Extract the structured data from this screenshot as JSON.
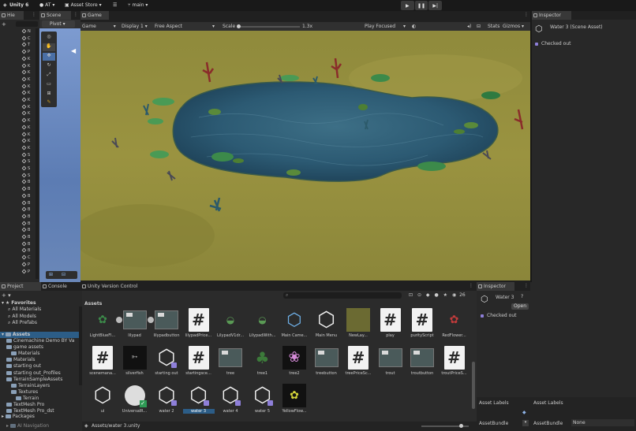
{
  "toolbar": {
    "app_name": "Unity 6",
    "account": "AT",
    "asset_store": "Asset Store",
    "branch": "main"
  },
  "hierarchy": {
    "tab_label": "Hie",
    "add_label": "+",
    "item_letters": [
      "N",
      "C",
      "T",
      "P",
      "K",
      "K",
      "K",
      "K",
      "K",
      "K",
      "K",
      "K",
      "K",
      "K",
      "K",
      "K",
      "K",
      "K",
      "S",
      "S",
      "S",
      "S",
      "B",
      "B",
      "B",
      "B",
      "B",
      "B",
      "B",
      "B",
      "B",
      "B",
      "B",
      "C",
      "P",
      "P"
    ]
  },
  "scene": {
    "tab_label": "Scene",
    "pivot_label": "Pivot"
  },
  "game": {
    "tab_label": "Game",
    "display_mode": "Game",
    "display": "Display 1",
    "aspect": "Free Aspect",
    "scale_label": "Scale",
    "scale_value": "1.3x",
    "play_mode": "Play Focused",
    "stats_label": "Stats",
    "gizmos_label": "Gizmos"
  },
  "inspector_top": {
    "tab_label": "Inspector",
    "object_name": "Water 3 (Scene Asset)",
    "status": "Checked out"
  },
  "bottom_tabs": {
    "project": "Project",
    "console": "Console",
    "version_control": "Unity Version Control"
  },
  "project": {
    "favorites_label": "Favorites",
    "favorites": [
      "All Materials",
      "All Models",
      "All Prefabs"
    ],
    "assets_label": "Assets",
    "tree": [
      {
        "label": "Cinemachine Demo BY Va",
        "indent": 1
      },
      {
        "label": "game assets",
        "indent": 1
      },
      {
        "label": "Materials",
        "indent": 2
      },
      {
        "label": "Materials",
        "indent": 1
      },
      {
        "label": "starting out",
        "indent": 1
      },
      {
        "label": "starting out_Profiles",
        "indent": 1
      },
      {
        "label": "TerrainSampleAssets",
        "indent": 1
      },
      {
        "label": "TerrainLayers",
        "indent": 2
      },
      {
        "label": "Textures",
        "indent": 2
      },
      {
        "label": "Terrain",
        "indent": 3
      },
      {
        "label": "TextMesh Pro",
        "indent": 1
      },
      {
        "label": "TextMesh Pro_dst",
        "indent": 1
      }
    ],
    "packages_label": "Packages",
    "packages_child": "AI Navigation",
    "breadcrumb": "Assets",
    "search_placeholder": "",
    "item_count": "26",
    "footer_path": "Assets/water 3.unity"
  },
  "assets": {
    "row1": [
      "LightBlueFl...",
      "lilypad",
      "lilypadbutton",
      "lilypadPrice...",
      "LilypadV1dr...",
      "LilypadWith...",
      "Main Came...",
      "Main Menu",
      "NewLay...",
      "play",
      "purityScript",
      "RedFlower..."
    ],
    "row2": [
      "scenemana...",
      "silverfish",
      "starting out",
      "startingsce...",
      "tree",
      "tree1",
      "tree2",
      "treebutton",
      "treePriceSc...",
      "trout",
      "troutbutton",
      "troutPriceS..."
    ],
    "row3": [
      "ui",
      "UniversalR...",
      "water 2",
      "water 3",
      "water 4",
      "water 5",
      "YellowFlow..."
    ]
  },
  "inspector_bottom": {
    "tab_label": "Inspector",
    "object_name": "Water 3",
    "open_label": "Open",
    "status": "Checked out",
    "asset_labels": "Asset Labels",
    "asset_bundle": "AssetBundle"
  },
  "right_bottom": {
    "asset_labels": "Asset Labels",
    "asset_bundle": "AssetBundle",
    "bundle_value": "None"
  }
}
